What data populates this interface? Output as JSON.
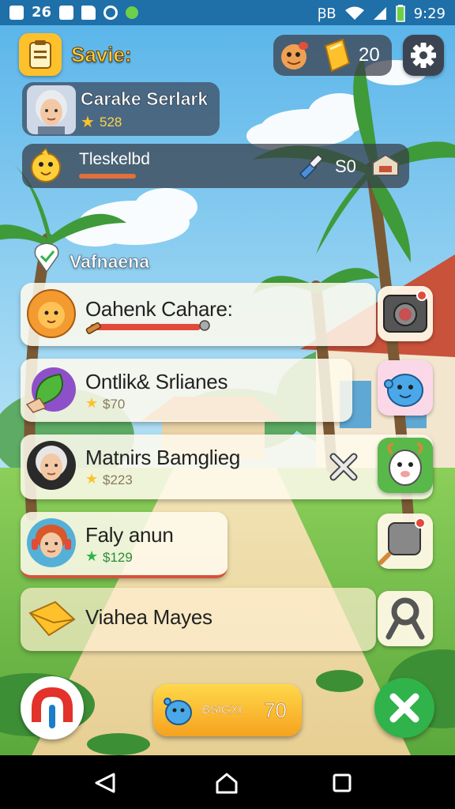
{
  "status_bar": {
    "left_text": "26",
    "right_signal_text": "ꞴB",
    "time": "9:29"
  },
  "header": {
    "title": "Savie:",
    "currency_value": "20",
    "profile_name": "Carake Serlark",
    "profile_score": "528",
    "quest_label": "Tleskelbd",
    "quest_value": "S0"
  },
  "section": {
    "label": "Vafnaena"
  },
  "list": [
    {
      "name": "Oahenk Cahare:",
      "value": "",
      "icon": "lion-icon",
      "action_icon": "camera-icon"
    },
    {
      "name": "Ontlik& Srlianes",
      "value": "$70",
      "icon": "leaf-icon",
      "action_icon": "blob-creature-icon"
    },
    {
      "name": "Matnirs Bamglieg",
      "value": "$223",
      "icon": "woman-avatar",
      "action_icon": "goat-icon"
    },
    {
      "name": "Faly anun",
      "value": "$129",
      "icon": "headphone-avatar",
      "action_icon": "frying-pan-icon"
    },
    {
      "name": "Viahea Mayes",
      "value": "",
      "icon": "envelope-icon",
      "action_icon": "wrench-icon"
    }
  ],
  "bottom": {
    "center_label": "BSIGXI",
    "center_value": "70"
  },
  "colors": {
    "accent_yellow": "#ffc12b",
    "accent_green": "#2fb34a",
    "accent_red": "#e24a3a",
    "panel_dark": "#3c3c46"
  }
}
